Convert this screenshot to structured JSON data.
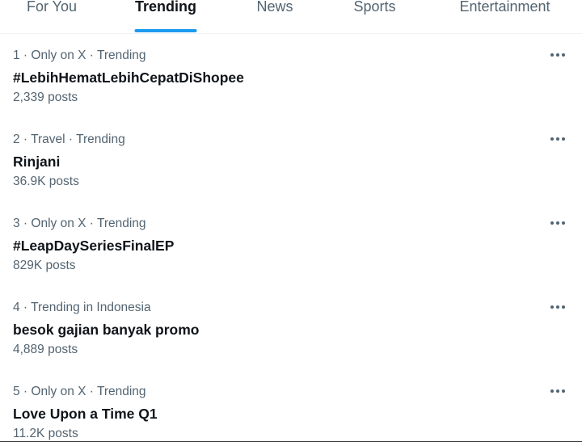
{
  "colors": {
    "accent": "#1d9bf0",
    "text_primary": "#0f1419",
    "text_secondary": "#536471",
    "divider": "#eff3f4"
  },
  "tabs": [
    {
      "label": "For You",
      "active": false
    },
    {
      "label": "Trending",
      "active": true
    },
    {
      "label": "News",
      "active": false
    },
    {
      "label": "Sports",
      "active": false
    },
    {
      "label": "Entertainment",
      "active": false
    }
  ],
  "trends": [
    {
      "context": "1 · Only on X · Trending",
      "name": "#LebihHematLebihCepatDiShopee",
      "count": "2,339 posts",
      "more_icon": "more-horizontal-icon"
    },
    {
      "context": "2 · Travel · Trending",
      "name": "Rinjani",
      "count": "36.9K posts",
      "more_icon": "more-horizontal-icon"
    },
    {
      "context": "3 · Only on X · Trending",
      "name": "#LeapDaySeriesFinalEP",
      "count": "829K posts",
      "more_icon": "more-horizontal-icon"
    },
    {
      "context": "4 · Trending in Indonesia",
      "name": "besok gajian banyak promo",
      "count": "4,889 posts",
      "more_icon": "more-horizontal-icon"
    },
    {
      "context": "5 · Only on X · Trending",
      "name": "Love Upon a Time Q1",
      "count": "11.2K posts",
      "more_icon": "more-horizontal-icon"
    }
  ]
}
